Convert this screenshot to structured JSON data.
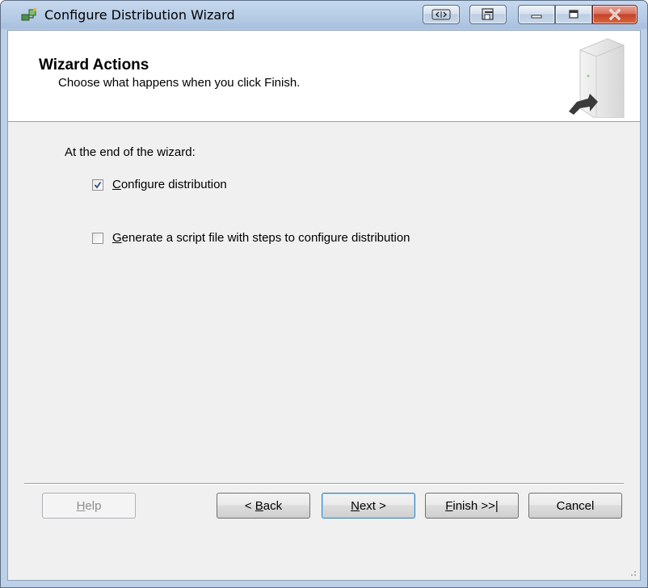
{
  "window": {
    "title": "Configure Distribution Wizard"
  },
  "header": {
    "title": "Wizard Actions",
    "subtitle": "Choose what happens when you click Finish."
  },
  "main": {
    "intro": "At the end of the wizard:",
    "options": [
      {
        "label_prefix": "",
        "mnemonic": "C",
        "label_rest": "onfigure distribution",
        "checked": true
      },
      {
        "label_prefix": "",
        "mnemonic": "G",
        "label_rest": "enerate a script file with steps to configure distribution",
        "checked": false
      }
    ]
  },
  "buttons": {
    "help": {
      "mnemonic": "H",
      "rest": "elp"
    },
    "back": {
      "prefix": "< ",
      "mnemonic": "B",
      "rest": "ack"
    },
    "next": {
      "mnemonic": "N",
      "rest": "ext >"
    },
    "finish": {
      "mnemonic": "F",
      "rest": "inish >>|"
    },
    "cancel": {
      "label": "Cancel"
    }
  },
  "colors": {
    "title_bar": "#b6cce6",
    "close_button": "#c4432b",
    "default_button_border": "#3c7fb1",
    "check_mark": "#2b4f8a"
  },
  "icons": {
    "app": "wizard-icon",
    "header_art": "server-arrow-icon",
    "check": "checkmark-icon"
  }
}
